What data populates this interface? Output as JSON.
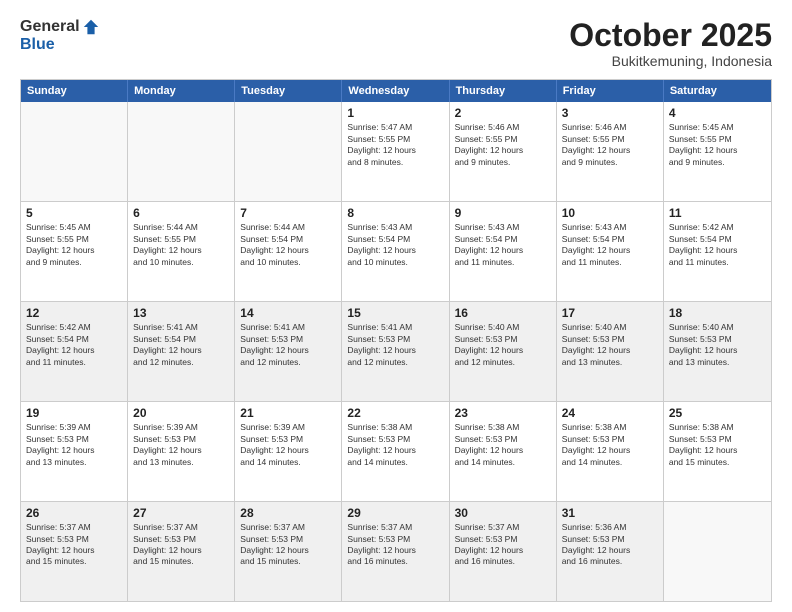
{
  "logo": {
    "general": "General",
    "blue": "Blue"
  },
  "header": {
    "month": "October 2025",
    "location": "Bukitkemuning, Indonesia"
  },
  "weekdays": [
    "Sunday",
    "Monday",
    "Tuesday",
    "Wednesday",
    "Thursday",
    "Friday",
    "Saturday"
  ],
  "rows": [
    [
      {
        "day": "",
        "info": "",
        "empty": true
      },
      {
        "day": "",
        "info": "",
        "empty": true
      },
      {
        "day": "",
        "info": "",
        "empty": true
      },
      {
        "day": "1",
        "info": "Sunrise: 5:47 AM\nSunset: 5:55 PM\nDaylight: 12 hours\nand 8 minutes."
      },
      {
        "day": "2",
        "info": "Sunrise: 5:46 AM\nSunset: 5:55 PM\nDaylight: 12 hours\nand 9 minutes."
      },
      {
        "day": "3",
        "info": "Sunrise: 5:46 AM\nSunset: 5:55 PM\nDaylight: 12 hours\nand 9 minutes."
      },
      {
        "day": "4",
        "info": "Sunrise: 5:45 AM\nSunset: 5:55 PM\nDaylight: 12 hours\nand 9 minutes."
      }
    ],
    [
      {
        "day": "5",
        "info": "Sunrise: 5:45 AM\nSunset: 5:55 PM\nDaylight: 12 hours\nand 9 minutes."
      },
      {
        "day": "6",
        "info": "Sunrise: 5:44 AM\nSunset: 5:55 PM\nDaylight: 12 hours\nand 10 minutes."
      },
      {
        "day": "7",
        "info": "Sunrise: 5:44 AM\nSunset: 5:54 PM\nDaylight: 12 hours\nand 10 minutes."
      },
      {
        "day": "8",
        "info": "Sunrise: 5:43 AM\nSunset: 5:54 PM\nDaylight: 12 hours\nand 10 minutes."
      },
      {
        "day": "9",
        "info": "Sunrise: 5:43 AM\nSunset: 5:54 PM\nDaylight: 12 hours\nand 11 minutes."
      },
      {
        "day": "10",
        "info": "Sunrise: 5:43 AM\nSunset: 5:54 PM\nDaylight: 12 hours\nand 11 minutes."
      },
      {
        "day": "11",
        "info": "Sunrise: 5:42 AM\nSunset: 5:54 PM\nDaylight: 12 hours\nand 11 minutes."
      }
    ],
    [
      {
        "day": "12",
        "info": "Sunrise: 5:42 AM\nSunset: 5:54 PM\nDaylight: 12 hours\nand 11 minutes.",
        "shaded": true
      },
      {
        "day": "13",
        "info": "Sunrise: 5:41 AM\nSunset: 5:54 PM\nDaylight: 12 hours\nand 12 minutes.",
        "shaded": true
      },
      {
        "day": "14",
        "info": "Sunrise: 5:41 AM\nSunset: 5:53 PM\nDaylight: 12 hours\nand 12 minutes.",
        "shaded": true
      },
      {
        "day": "15",
        "info": "Sunrise: 5:41 AM\nSunset: 5:53 PM\nDaylight: 12 hours\nand 12 minutes.",
        "shaded": true
      },
      {
        "day": "16",
        "info": "Sunrise: 5:40 AM\nSunset: 5:53 PM\nDaylight: 12 hours\nand 12 minutes.",
        "shaded": true
      },
      {
        "day": "17",
        "info": "Sunrise: 5:40 AM\nSunset: 5:53 PM\nDaylight: 12 hours\nand 13 minutes.",
        "shaded": true
      },
      {
        "day": "18",
        "info": "Sunrise: 5:40 AM\nSunset: 5:53 PM\nDaylight: 12 hours\nand 13 minutes.",
        "shaded": true
      }
    ],
    [
      {
        "day": "19",
        "info": "Sunrise: 5:39 AM\nSunset: 5:53 PM\nDaylight: 12 hours\nand 13 minutes."
      },
      {
        "day": "20",
        "info": "Sunrise: 5:39 AM\nSunset: 5:53 PM\nDaylight: 12 hours\nand 13 minutes."
      },
      {
        "day": "21",
        "info": "Sunrise: 5:39 AM\nSunset: 5:53 PM\nDaylight: 12 hours\nand 14 minutes."
      },
      {
        "day": "22",
        "info": "Sunrise: 5:38 AM\nSunset: 5:53 PM\nDaylight: 12 hours\nand 14 minutes."
      },
      {
        "day": "23",
        "info": "Sunrise: 5:38 AM\nSunset: 5:53 PM\nDaylight: 12 hours\nand 14 minutes."
      },
      {
        "day": "24",
        "info": "Sunrise: 5:38 AM\nSunset: 5:53 PM\nDaylight: 12 hours\nand 14 minutes."
      },
      {
        "day": "25",
        "info": "Sunrise: 5:38 AM\nSunset: 5:53 PM\nDaylight: 12 hours\nand 15 minutes."
      }
    ],
    [
      {
        "day": "26",
        "info": "Sunrise: 5:37 AM\nSunset: 5:53 PM\nDaylight: 12 hours\nand 15 minutes.",
        "shaded": true
      },
      {
        "day": "27",
        "info": "Sunrise: 5:37 AM\nSunset: 5:53 PM\nDaylight: 12 hours\nand 15 minutes.",
        "shaded": true
      },
      {
        "day": "28",
        "info": "Sunrise: 5:37 AM\nSunset: 5:53 PM\nDaylight: 12 hours\nand 15 minutes.",
        "shaded": true
      },
      {
        "day": "29",
        "info": "Sunrise: 5:37 AM\nSunset: 5:53 PM\nDaylight: 12 hours\nand 16 minutes.",
        "shaded": true
      },
      {
        "day": "30",
        "info": "Sunrise: 5:37 AM\nSunset: 5:53 PM\nDaylight: 12 hours\nand 16 minutes.",
        "shaded": true
      },
      {
        "day": "31",
        "info": "Sunrise: 5:36 AM\nSunset: 5:53 PM\nDaylight: 12 hours\nand 16 minutes.",
        "shaded": true
      },
      {
        "day": "",
        "info": "",
        "empty": true,
        "shaded": true
      }
    ]
  ]
}
